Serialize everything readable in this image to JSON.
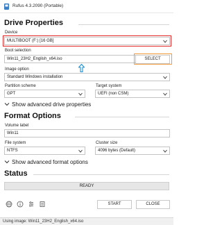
{
  "window": {
    "title": "Rufus 4.3.2090 (Portable)"
  },
  "drive_properties": {
    "heading": "Drive Properties",
    "device_label": "Device",
    "device_value": "MULTIBOOT (F:) [16 GB]",
    "boot_selection_label": "Boot selection",
    "boot_selection_value": "Win11_23H2_English_x64.iso",
    "select_button": "SELECT",
    "image_option_label": "Image option",
    "image_option_value": "Standard Windows installation",
    "partition_scheme_label": "Partition scheme",
    "partition_scheme_value": "GPT",
    "target_system_label": "Target system",
    "target_system_value": "UEFI (non CSM)",
    "advanced_toggle": "Show advanced drive properties"
  },
  "format_options": {
    "heading": "Format Options",
    "volume_label_label": "Volume label",
    "volume_label_value": "Win11",
    "file_system_label": "File system",
    "file_system_value": "NTFS",
    "cluster_size_label": "Cluster size",
    "cluster_size_value": "4096 bytes (Default)",
    "advanced_toggle": "Show advanced format options"
  },
  "status": {
    "heading": "Status",
    "state": "READY"
  },
  "actions": {
    "start": "START",
    "close": "CLOSE"
  },
  "footer": {
    "text": "Using image: Win11_23H2_English_x64.iso"
  },
  "colors": {
    "device_highlight": "#e22a2a",
    "select_highlight": "#f19a3a",
    "arrow_annotation": "#1a8fd6"
  },
  "icons": [
    "usb-drive-icon",
    "download-arrow-icon",
    "check-circle-icon",
    "chevron-down-icon",
    "globe-icon",
    "info-icon",
    "settings-icon",
    "log-icon",
    "up-arrow-annotation-icon"
  ]
}
